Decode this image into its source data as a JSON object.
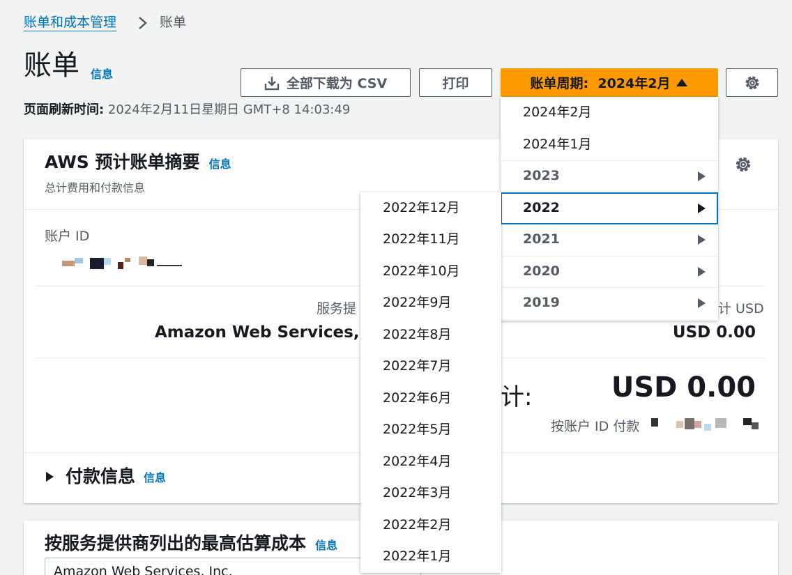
{
  "breadcrumb": {
    "parent": "账单和成本管理",
    "current": "账单"
  },
  "page": {
    "title": "账单",
    "info": "信息",
    "refresh_label": "页面刷新时间:",
    "refresh_value": " 2024年2月11日星期日 GMT+8 14:03:49"
  },
  "toolbar": {
    "csv_label": "全部下载为 CSV",
    "print_label": "打印",
    "period_label": "账单周期:  2024年2月"
  },
  "summary": {
    "title": "AWS 预计账单摘要",
    "info": "信息",
    "subtitle": "总计费用和付款信息",
    "account_id_label": "账户 ID",
    "provider_label": "服务提",
    "provider_name": "Amazon Web Services,",
    "amount_label_right": "计 USD",
    "amount_value": "USD 0.00",
    "total_colon": "计:",
    "total_value": "USD 0.00",
    "pay_by_account": "按账户 ID 付款",
    "payment_info": "付款信息",
    "payment_info_link": "信息"
  },
  "top_services": {
    "title": "按服务提供商列出的最高估算成本",
    "info": "信息",
    "select_value": "Amazon Web Services, Inc."
  },
  "period_menu": {
    "months": [
      "2024年2月",
      "2024年1月"
    ],
    "years": [
      "2023",
      "2022",
      "2021",
      "2020",
      "2019"
    ]
  },
  "submenu_2022": [
    "2022年12月",
    "2022年11月",
    "2022年10月",
    "2022年9月",
    "2022年8月",
    "2022年7月",
    "2022年6月",
    "2022年5月",
    "2022年4月",
    "2022年3月",
    "2022年2月",
    "2022年1月"
  ],
  "colors": {
    "accent": "#ff9900",
    "link": "#0073bb",
    "text": "#16191f",
    "muted": "#545b64"
  }
}
